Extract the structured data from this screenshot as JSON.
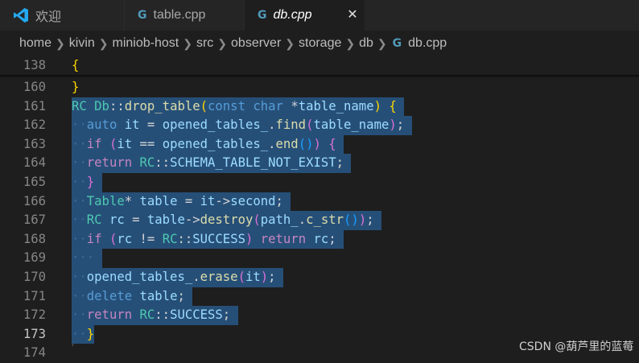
{
  "tabs": [
    {
      "label": "欢迎",
      "icon": "vscode-icon"
    },
    {
      "label": "table.cpp",
      "icon": "cpp-file-icon"
    },
    {
      "label": "db.cpp",
      "icon": "cpp-file-icon",
      "active": true
    }
  ],
  "breadcrumb": [
    "home",
    "kivin",
    "miniob-host",
    "src",
    "observer",
    "storage",
    "db",
    "db.cpp"
  ],
  "lines": {
    "n138": "138",
    "n160": "160",
    "n161": "161",
    "n162": "162",
    "n163": "163",
    "n164": "164",
    "n165": "165",
    "n166": "166",
    "n167": "167",
    "n168": "168",
    "n169": "169",
    "n170": "170",
    "n171": "171",
    "n172": "172",
    "n173": "173",
    "n174": "174"
  },
  "code": {
    "t_brace": "{",
    "t_rc": "RC",
    "t_db": "Db",
    "t_drop": "drop_table",
    "t_const": "const",
    "t_char": "char",
    "t_tname": "table_name",
    "t_auto": "auto",
    "t_it": "it",
    "t_opened": "opened_tables_",
    "t_find": "find",
    "t_if": "if",
    "t_end": "end",
    "t_return": "return",
    "t_notexist": "SCHEMA_TABLE_NOT_EXIST",
    "t_table": "Table",
    "t_tablevar": "table",
    "t_second": "second",
    "t_rcvar": "rc",
    "t_destroy": "destroy",
    "t_path": "path_",
    "t_cstr": "c_str",
    "t_success": "SUCCESS",
    "t_erase": "erase",
    "t_delete": "delete"
  },
  "colors": {
    "selection": "#264f78",
    "keyword": "#569cd6",
    "control": "#c586c0",
    "type": "#4ec9b0",
    "function": "#dcdcaa",
    "variable": "#9cdcfe"
  },
  "watermark": "CSDN @葫芦里的蓝莓"
}
